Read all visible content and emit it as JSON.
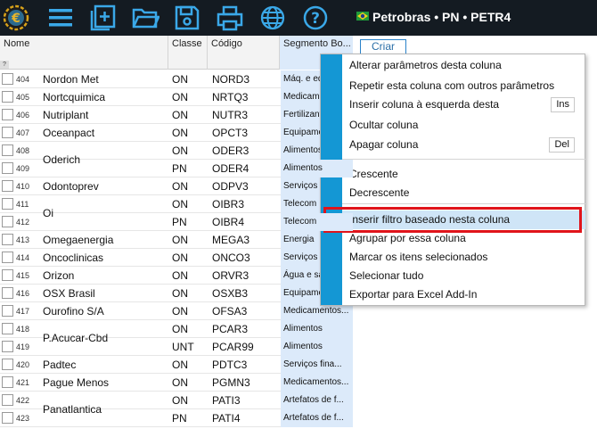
{
  "toolbar": {
    "icons": [
      "app-logo-icon",
      "menu-icon",
      "new-document-icon",
      "open-folder-icon",
      "save-icon",
      "print-icon",
      "globe-icon",
      "help-icon"
    ]
  },
  "header": {
    "title": "Petrobras • PN • PETR4",
    "flag": "brazil-flag-icon"
  },
  "tab": {
    "criar_label": "Criar"
  },
  "grid": {
    "columns": [
      "Nome",
      "Classe",
      "Código",
      "Segmento Bo..."
    ],
    "rows": [
      {
        "num": "404",
        "nome": "Nordon Met",
        "classe": "ON",
        "codigo": "NORD3",
        "seg": "Máq. e equ..."
      },
      {
        "num": "405",
        "nome": "Nortcquimica",
        "classe": "ON",
        "codigo": "NRTQ3",
        "seg": "Medicamentos"
      },
      {
        "num": "406",
        "nome": "Nutriplant",
        "classe": "ON",
        "codigo": "NUTR3",
        "seg": "Fertilizantes"
      },
      {
        "num": "407",
        "nome": "Oceanpact",
        "classe": "ON",
        "codigo": "OPCT3",
        "seg": "Equipamentos"
      },
      {
        "num": "408",
        "nome": "",
        "classe": "ON",
        "codigo": "ODER3",
        "seg": "Alimentos"
      },
      {
        "num": "409",
        "nome": "Oderich",
        "classe": "PN",
        "codigo": "ODER4",
        "seg": "Alimentos"
      },
      {
        "num": "410",
        "nome": "Odontoprev",
        "classe": "ON",
        "codigo": "ODPV3",
        "seg": "Serviços"
      },
      {
        "num": "411",
        "nome": "",
        "classe": "ON",
        "codigo": "OIBR3",
        "seg": "Telecom"
      },
      {
        "num": "412",
        "nome": "Oi",
        "classe": "PN",
        "codigo": "OIBR4",
        "seg": "Telecom"
      },
      {
        "num": "413",
        "nome": "Omegaenergia",
        "classe": "ON",
        "codigo": "MEGA3",
        "seg": "Energia"
      },
      {
        "num": "414",
        "nome": "Oncoclinicas",
        "classe": "ON",
        "codigo": "ONCO3",
        "seg": "Serviços"
      },
      {
        "num": "415",
        "nome": "Orizon",
        "classe": "ON",
        "codigo": "ORVR3",
        "seg": "Água e sa..."
      },
      {
        "num": "416",
        "nome": "OSX Brasil",
        "classe": "ON",
        "codigo": "OSXB3",
        "seg": "Equipamentos"
      },
      {
        "num": "417",
        "nome": "Ourofino S/A",
        "classe": "ON",
        "codigo": "OFSA3",
        "seg": "Medicamentos..."
      },
      {
        "num": "418",
        "nome": "",
        "classe": "ON",
        "codigo": "PCAR3",
        "seg": "Alimentos"
      },
      {
        "num": "419",
        "nome": "P.Acucar-Cbd",
        "classe": "UNT",
        "codigo": "PCAR99",
        "seg": "Alimentos"
      },
      {
        "num": "420",
        "nome": "Padtec",
        "classe": "ON",
        "codigo": "PDTC3",
        "seg": "Serviços fina..."
      },
      {
        "num": "421",
        "nome": "Pague Menos",
        "classe": "ON",
        "codigo": "PGMN3",
        "seg": "Medicamentos..."
      },
      {
        "num": "422",
        "nome": "",
        "classe": "ON",
        "codigo": "PATI3",
        "seg": "Artefatos de f..."
      },
      {
        "num": "423",
        "nome": "Panatlantica",
        "classe": "PN",
        "codigo": "PATI4",
        "seg": "Artefatos de f..."
      }
    ]
  },
  "context_menu": {
    "items": [
      {
        "label": "Alterar parâmetros desta coluna",
        "shortcut": ""
      },
      {
        "label": "Repetir esta coluna com outros parâmetros",
        "shortcut": ""
      },
      {
        "label": "Inserir coluna à esquerda desta",
        "shortcut": "Ins"
      },
      {
        "label": "Ocultar coluna",
        "shortcut": ""
      },
      {
        "label": "Apagar coluna",
        "shortcut": "Del"
      },
      {
        "label": "Crescente",
        "shortcut": ""
      },
      {
        "label": "Decrescente",
        "shortcut": ""
      },
      {
        "label": "Inserir filtro baseado nesta coluna",
        "shortcut": ""
      },
      {
        "label": "Agrupar por essa coluna",
        "shortcut": ""
      },
      {
        "label": "Marcar os itens selecionados",
        "shortcut": ""
      },
      {
        "label": "Selecionar tudo",
        "shortcut": ""
      },
      {
        "label": "Exportar para Excel Add-In",
        "shortcut": ""
      }
    ],
    "highlighted_index": 7
  },
  "colors": {
    "toolbar_bg": "#141b22",
    "icon_blue": "#3aa8e8",
    "menu_strip": "#1497d4",
    "highlight_border": "#e0141b",
    "segment_column_bg": "#dceafa"
  }
}
